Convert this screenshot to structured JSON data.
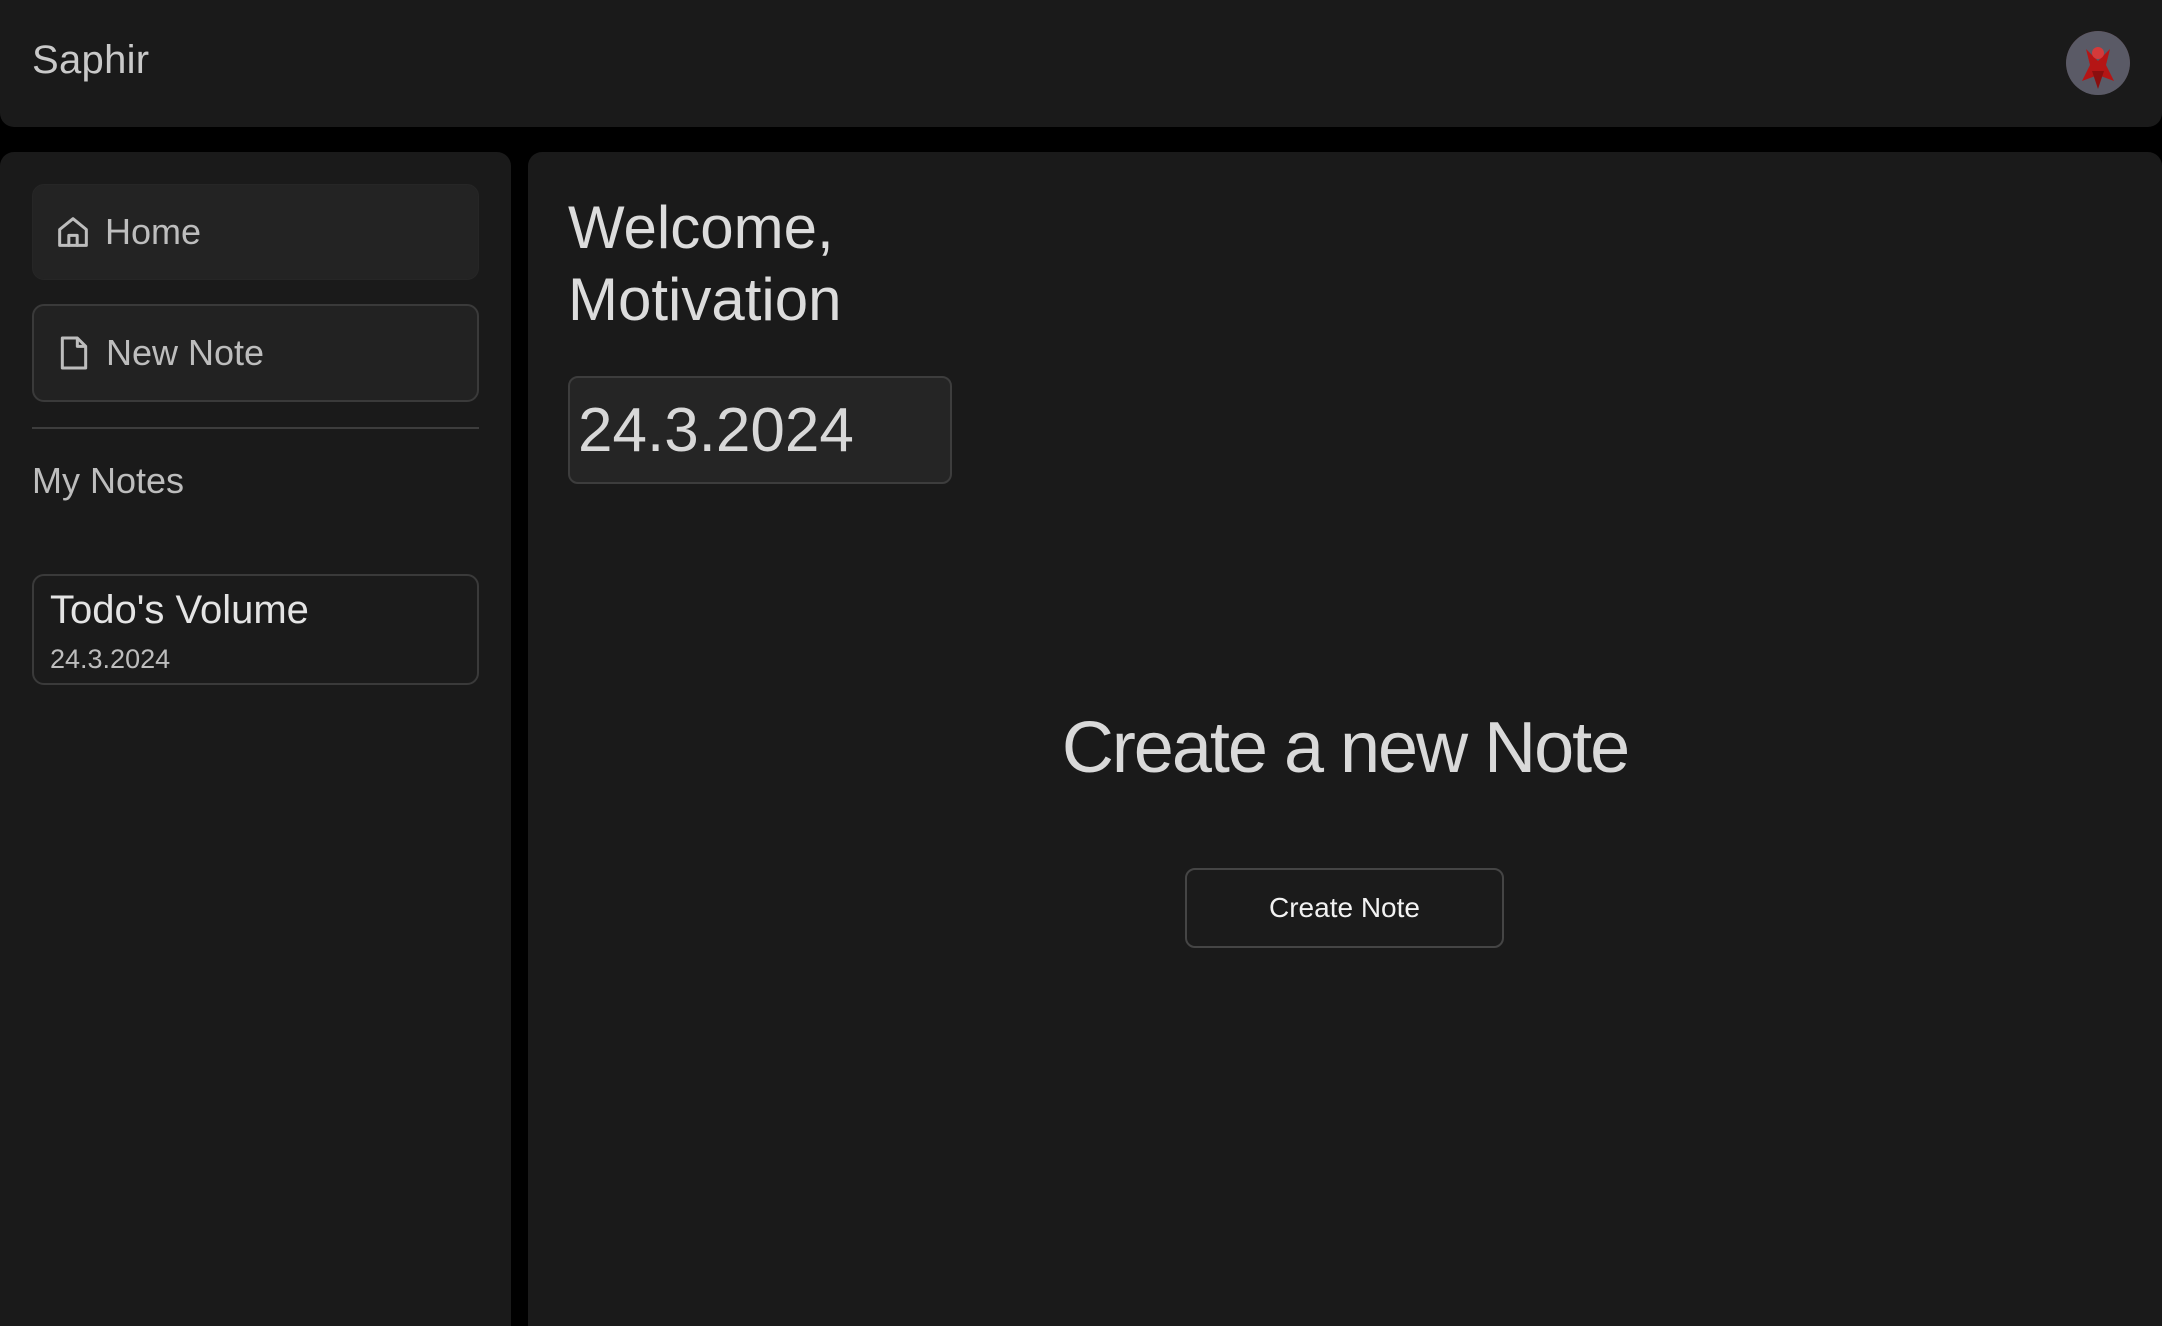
{
  "app": {
    "brand": "Saphir"
  },
  "sidebar": {
    "items": [
      {
        "label": "Home",
        "icon": "home-icon"
      },
      {
        "label": "New Note",
        "icon": "document-icon"
      }
    ],
    "section_label": "My Notes",
    "notes": [
      {
        "title": "Todo's Volume",
        "date": "24.3.2024"
      }
    ]
  },
  "main": {
    "welcome": "Welcome, Motivation",
    "date": "24.3.2024",
    "heading": "Create a new Note",
    "button_label": "Create Note"
  },
  "colors": {
    "background": "#000000",
    "panel": "#1a1a1a",
    "active_item": "#232323",
    "border": "#3a3a3a",
    "text": "#d6d6d6"
  }
}
